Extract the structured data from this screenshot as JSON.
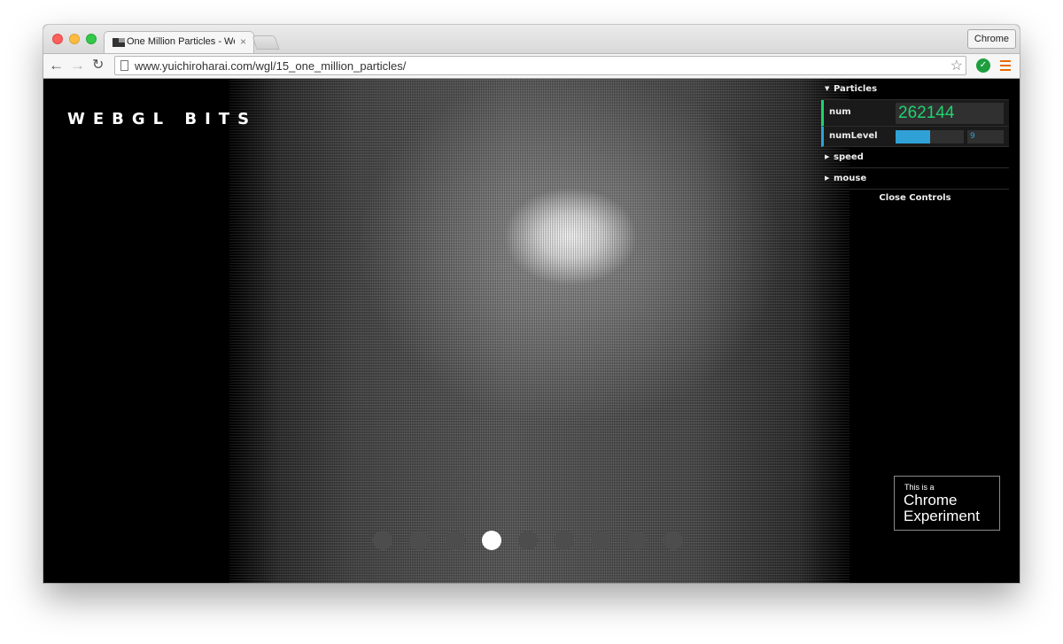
{
  "browser": {
    "tab_title": "One Million Particles - WebGL",
    "tab_close": "×",
    "profile_label": "Chrome",
    "url": "www.yuichiroharai.com/wgl/15_one_million_particles/"
  },
  "page": {
    "site_title": "WEBGL BITS",
    "chrome_experiment": {
      "line1": "This is a",
      "line2": "Chrome Experiment"
    },
    "slides": {
      "count": 9,
      "active_index": 3
    }
  },
  "controls": {
    "particles_folder": "Particles",
    "num_label": "num",
    "num_value": "262144",
    "numlevel_label": "numLevel",
    "numlevel_value": "9",
    "numlevel_fraction": 0.5,
    "speed_folder": "speed",
    "mouse_folder": "mouse",
    "close_label": "Close Controls"
  },
  "colors": {
    "num_accent": "#1ed36f",
    "slider_accent": "#2fa1d6"
  }
}
